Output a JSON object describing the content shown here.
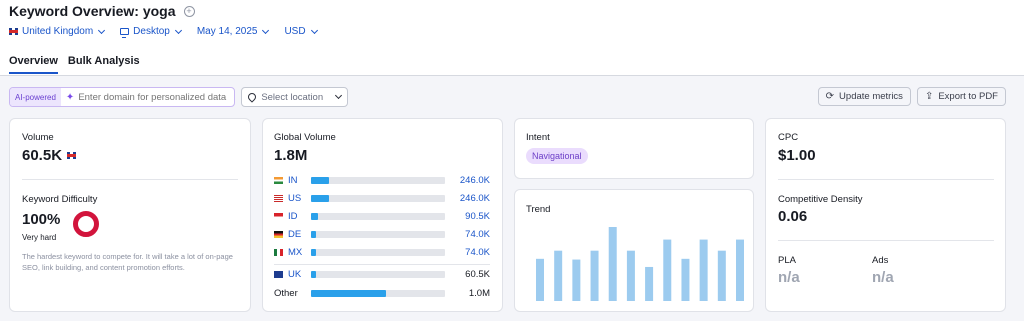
{
  "header": {
    "title_prefix": "Keyword Overview:",
    "keyword": "yoga",
    "filters": {
      "database": "United Kingdom",
      "device": "Desktop",
      "date": "May 14, 2025",
      "currency": "USD"
    },
    "tabs": [
      {
        "label": "Overview",
        "active": true
      },
      {
        "label": "Bulk Analysis",
        "active": false
      }
    ]
  },
  "toolbar": {
    "ai_badge": "AI-powered",
    "domain_placeholder": "Enter domain for personalized data",
    "location_placeholder": "Select location",
    "update_metrics": "Update metrics",
    "export_pdf": "Export to PDF"
  },
  "volume": {
    "label": "Volume",
    "value": "60.5K"
  },
  "keyword_difficulty": {
    "label": "Keyword Difficulty",
    "value": "100%",
    "level": "Very hard",
    "description": "The hardest keyword to compete for. It will take a lot of on-page SEO, link building, and content promotion efforts.",
    "percent": 100,
    "color": "#d2143c"
  },
  "global_volume": {
    "label": "Global Volume",
    "value": "1.8M",
    "countries": [
      {
        "code": "IN",
        "value": "246.0K",
        "share": 0.135
      },
      {
        "code": "US",
        "value": "246.0K",
        "share": 0.135
      },
      {
        "code": "ID",
        "value": "90.5K",
        "share": 0.05
      },
      {
        "code": "DE",
        "value": "74.0K",
        "share": 0.041
      },
      {
        "code": "MX",
        "value": "74.0K",
        "share": 0.041
      }
    ],
    "uk": {
      "code": "UK",
      "value": "60.5K",
      "share": 0.034
    },
    "other": {
      "label": "Other",
      "value": "1.0M",
      "share": 0.56
    },
    "bar_color": "#2aa0ea"
  },
  "intent": {
    "label": "Intent",
    "value": "Navigational"
  },
  "trend": {
    "label": "Trend",
    "values": [
      0.57,
      0.68,
      0.56,
      0.68,
      1.0,
      0.68,
      0.46,
      0.83,
      0.57,
      0.83,
      0.68,
      0.83
    ],
    "bar_color": "#9ccbef"
  },
  "cpc": {
    "label": "CPC",
    "value": "$1.00"
  },
  "competitive_density": {
    "label": "Competitive Density",
    "value": "0.06"
  },
  "pla": {
    "label": "PLA",
    "value": "n/a"
  },
  "ads": {
    "label": "Ads",
    "value": "n/a"
  }
}
